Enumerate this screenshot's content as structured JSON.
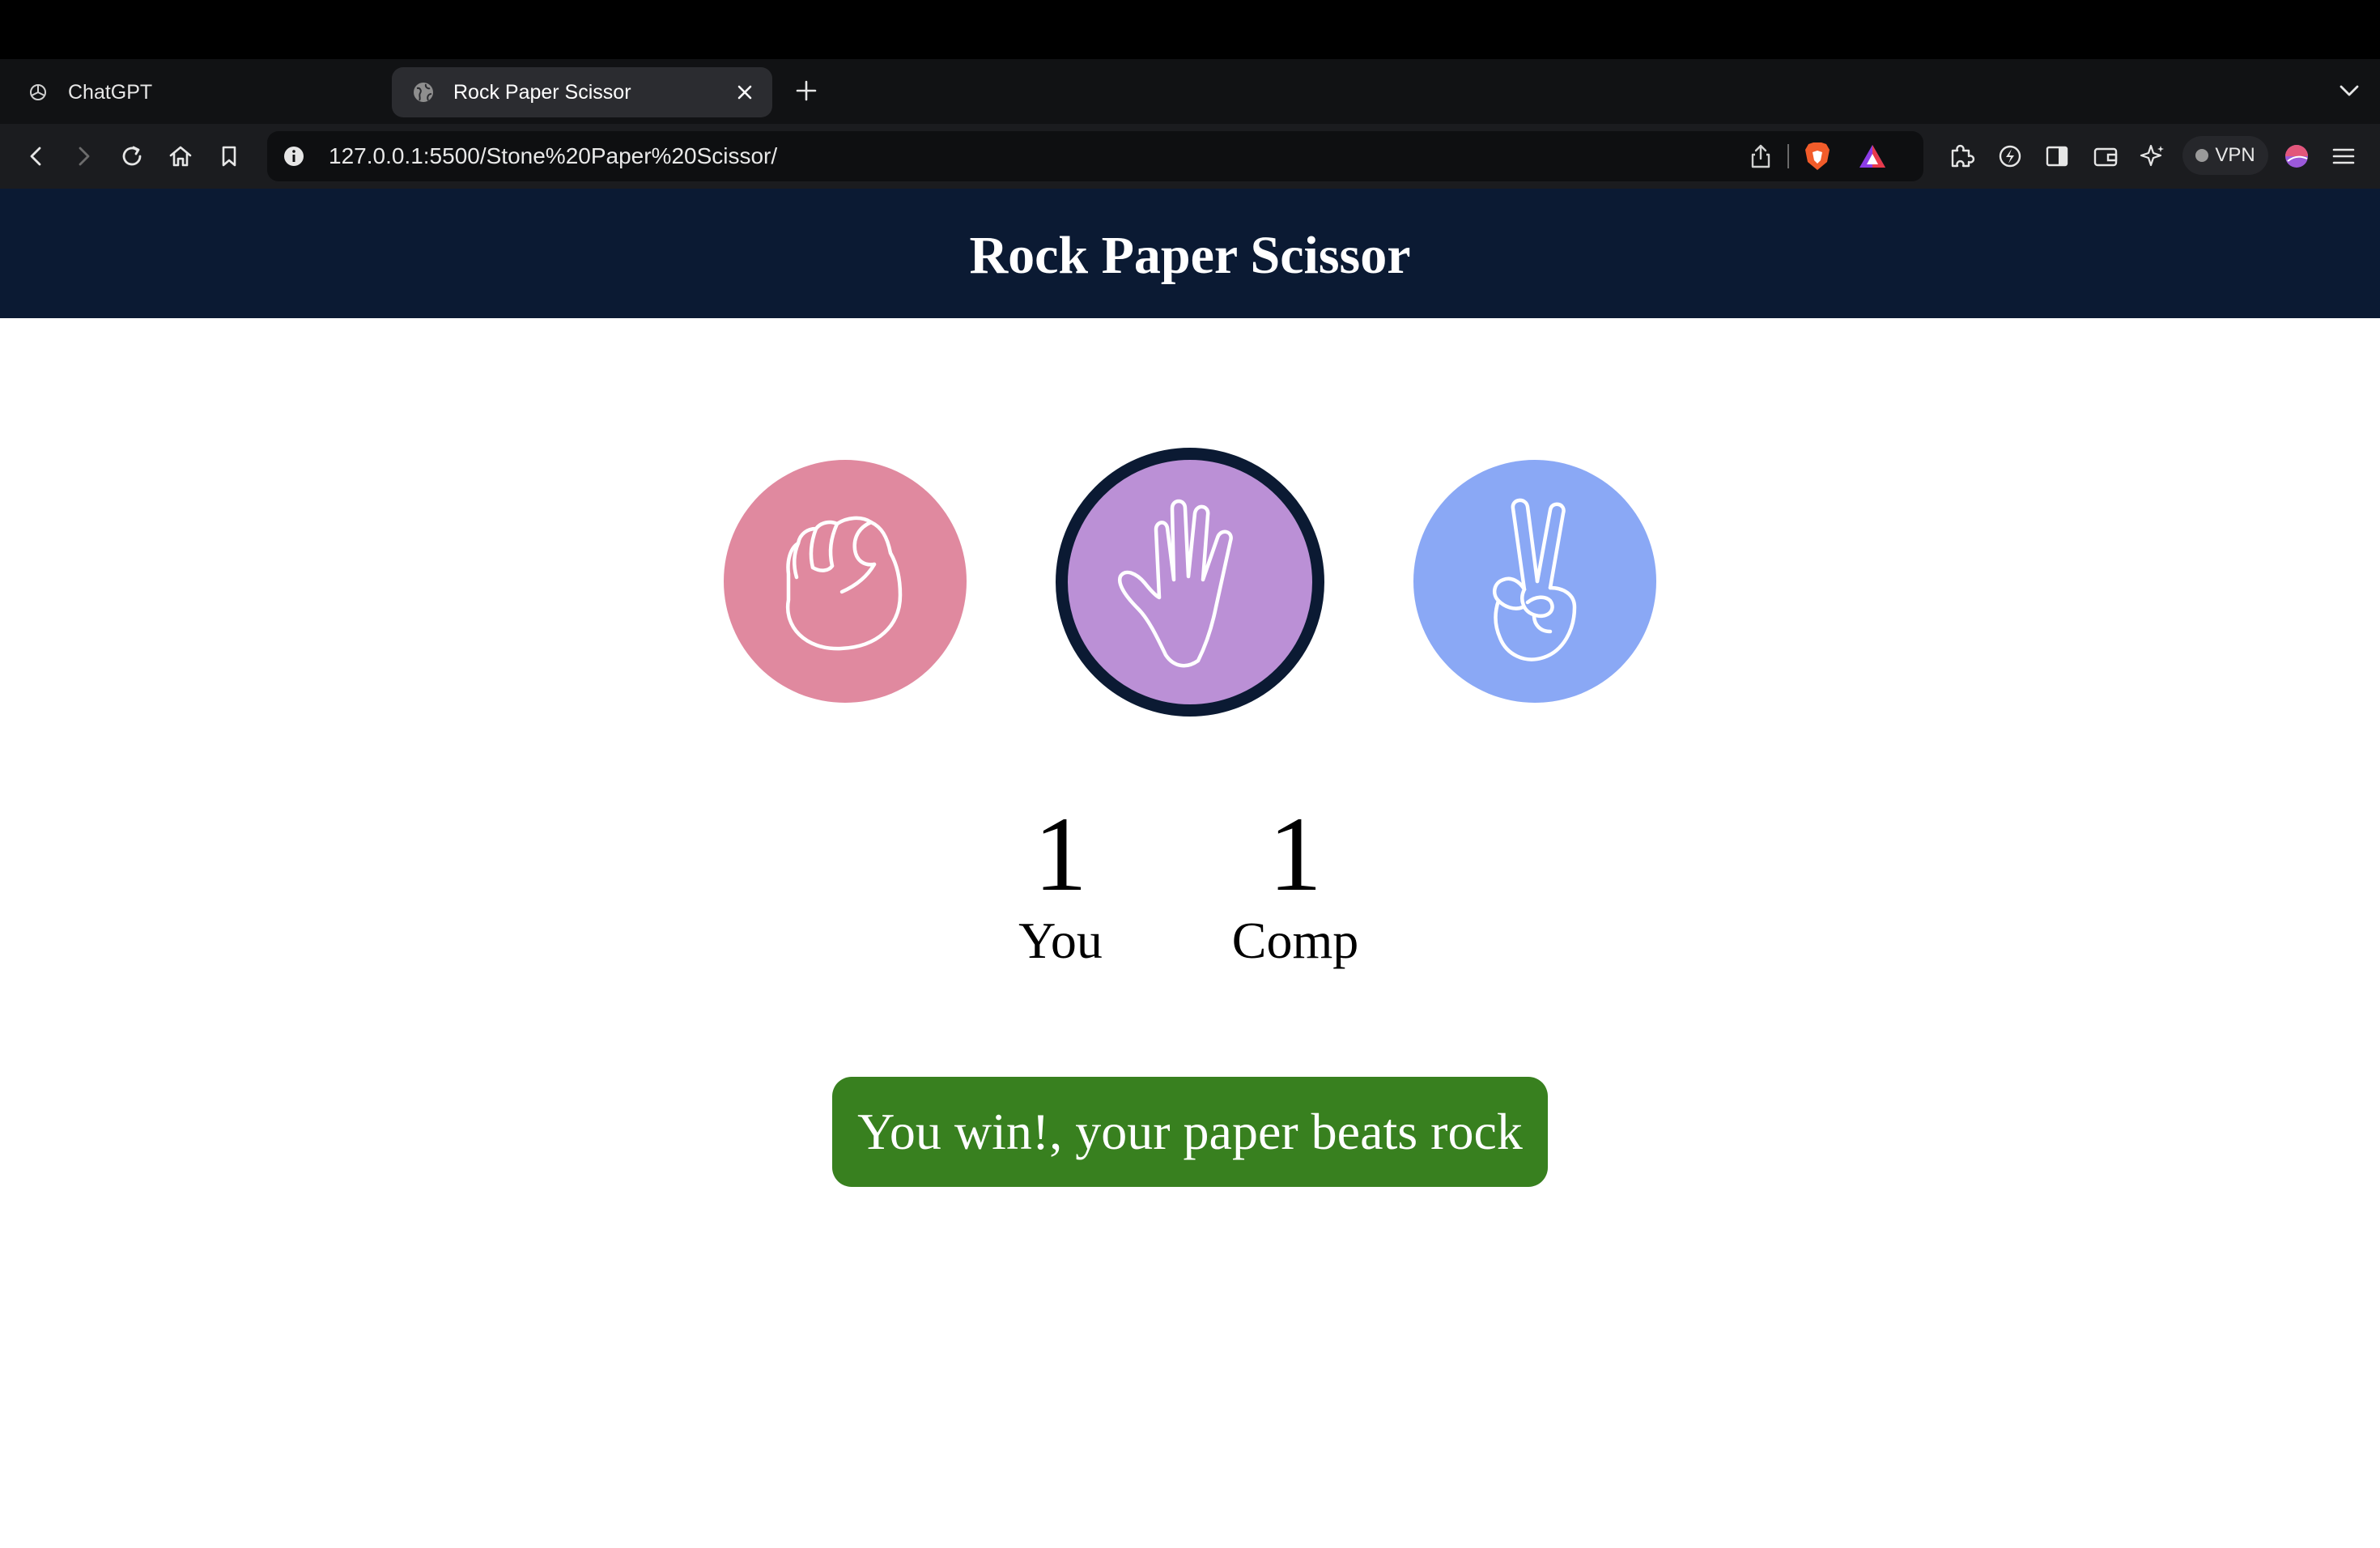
{
  "browser": {
    "tabs": [
      {
        "title": "ChatGPT",
        "active": false,
        "icon": "openai-icon"
      },
      {
        "title": "Rock Paper Scissor",
        "active": true,
        "icon": "globe-icon"
      }
    ],
    "url": "127.0.0.1:5500/Stone%20Paper%20Scissor/",
    "vpn_label": "VPN"
  },
  "page": {
    "title": "Rock Paper Scissor",
    "choices": [
      {
        "name": "rock",
        "icon": "fist-icon",
        "color": "#e0899f",
        "selected": false
      },
      {
        "name": "paper",
        "icon": "open-hand-icon",
        "color": "#bb90d6",
        "selected": true
      },
      {
        "name": "scissors",
        "icon": "peace-hand-icon",
        "color": "#8aa8f5",
        "selected": false
      }
    ],
    "scores": {
      "user": {
        "value": "1",
        "label": "You"
      },
      "comp": {
        "value": "1",
        "label": "Comp"
      }
    },
    "message": "You win!, your paper beats rock",
    "colors": {
      "header_bg": "#0b1a33",
      "message_bg": "#38801f"
    }
  }
}
